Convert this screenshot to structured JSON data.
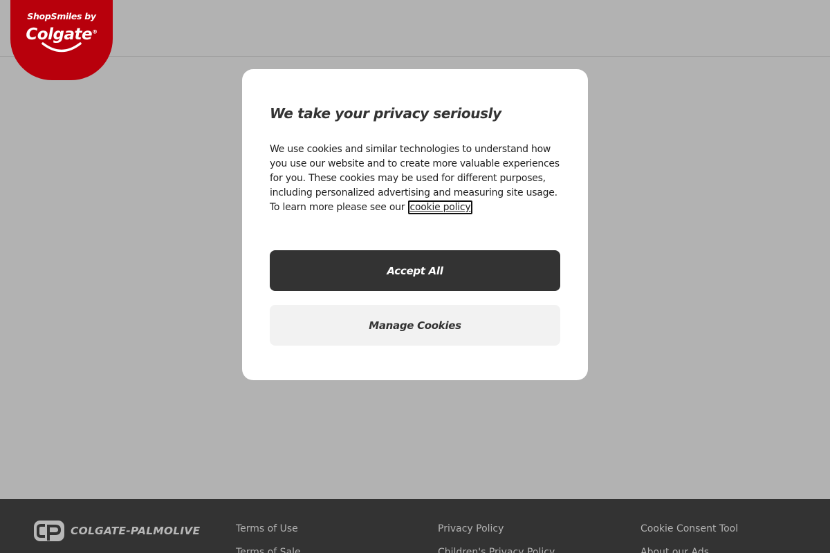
{
  "header": {
    "logo": {
      "subtitle": "ShopSmiles by",
      "brand": "Colgate",
      "registered_mark": "®",
      "color": "#b8000c"
    }
  },
  "modal": {
    "title": "We take your privacy seriously",
    "body_text": "We use cookies and similar technologies to understand how you use our website and to create more valuable experiences for you. These cookies may be used for different purposes, including personalized advertising and measuring site usage. To learn more please see our",
    "policy_link": "cookie policy",
    "accept_label": "Accept All",
    "manage_label": "Manage Cookies"
  },
  "footer": {
    "logo_text": "COLGATE-PALMOLIVE",
    "columns": [
      [
        "Terms of Use",
        "Terms of Sale"
      ],
      [
        "Privacy Policy",
        "Children's Privacy Policy"
      ],
      [
        "Cookie Consent Tool",
        "About our Ads"
      ]
    ]
  },
  "colors": {
    "overlay_background": "#b2b2b2",
    "accept_button": "#333333",
    "manage_button": "#f2f2f2",
    "footer_background": "#333333"
  }
}
